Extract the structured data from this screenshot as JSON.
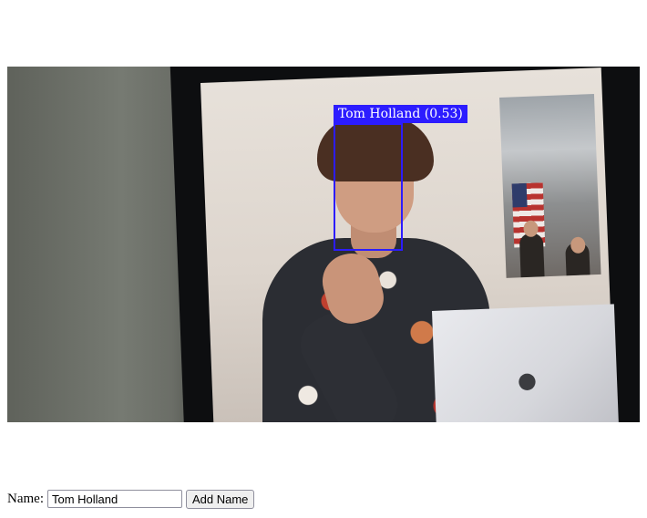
{
  "detection": {
    "label": "Tom Holland (0.53)",
    "box_color": "#2c1cff"
  },
  "form": {
    "label": "Name:",
    "input_value": "Tom Holland",
    "button_label": "Add Name"
  }
}
